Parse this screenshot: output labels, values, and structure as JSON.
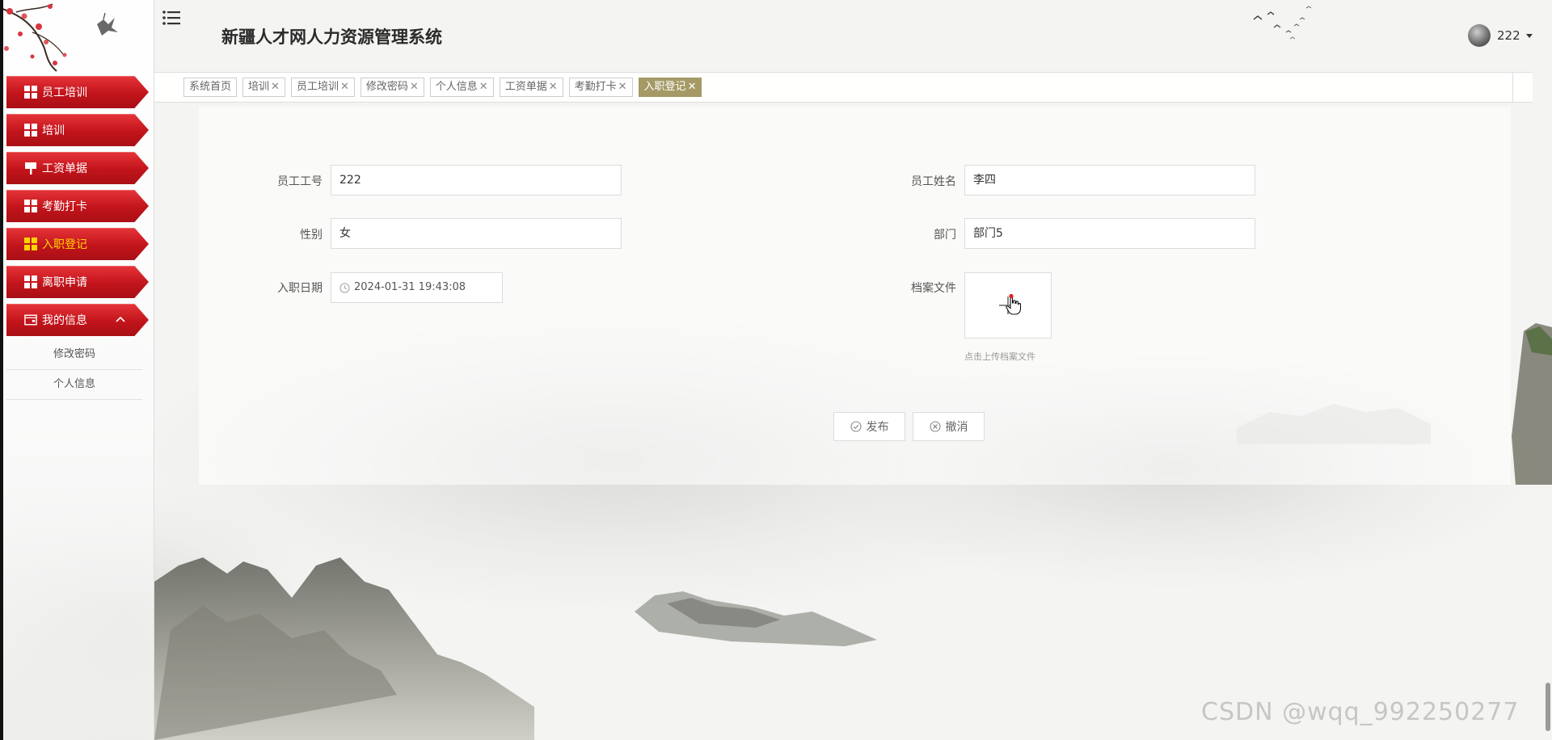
{
  "header": {
    "title": "新疆人才网人力资源管理系统",
    "user_name": "222"
  },
  "sidebar": {
    "items": [
      {
        "label": "员工培训",
        "icon": "grid-icon"
      },
      {
        "label": "培训",
        "icon": "grid-icon"
      },
      {
        "label": "工资单据",
        "icon": "sign-icon"
      },
      {
        "label": "考勤打卡",
        "icon": "grid-icon"
      },
      {
        "label": "入职登记",
        "icon": "grid-icon",
        "active": true
      },
      {
        "label": "离职申请",
        "icon": "grid-icon"
      },
      {
        "label": "我的信息",
        "icon": "wallet-icon",
        "expanded": true
      }
    ],
    "submenu": [
      "修改密码",
      "个人信息"
    ]
  },
  "tabs": [
    {
      "label": "系统首页",
      "closable": false
    },
    {
      "label": "培训",
      "closable": true
    },
    {
      "label": "员工培训",
      "closable": true
    },
    {
      "label": "修改密码",
      "closable": true
    },
    {
      "label": "个人信息",
      "closable": true
    },
    {
      "label": "工资单据",
      "closable": true
    },
    {
      "label": "考勤打卡",
      "closable": true
    },
    {
      "label": "入职登记",
      "closable": true,
      "active": true
    }
  ],
  "tab_close_glyph": "✕",
  "form": {
    "employee_id": {
      "label": "员工工号",
      "value": "222"
    },
    "employee_name": {
      "label": "员工姓名",
      "value": "李四"
    },
    "gender": {
      "label": "性别",
      "value": "女"
    },
    "department": {
      "label": "部门",
      "value": "部门5"
    },
    "hire_date": {
      "label": "入职日期",
      "value": "2024-01-31 19:43:08"
    },
    "archive_file": {
      "label": "档案文件",
      "hint": "点击上传档案文件"
    },
    "submit_label": "发布",
    "cancel_label": "撤消"
  },
  "watermark": "CSDN @wqq_992250277",
  "colors": {
    "menu_red": "#c2141b",
    "menu_active_text": "#ffd400",
    "tab_active": "#a59a66"
  }
}
